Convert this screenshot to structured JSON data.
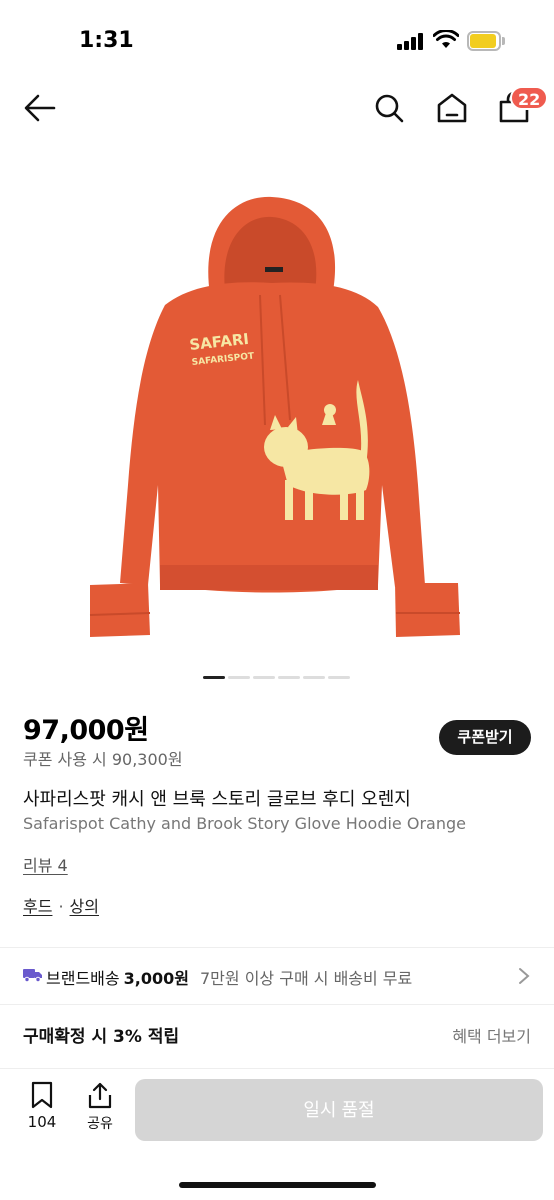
{
  "status_bar": {
    "time": "1:31"
  },
  "nav": {
    "cart_count": "22"
  },
  "gallery": {
    "total_images": 6,
    "active_index": 0,
    "print_text_1": "SAFARI",
    "print_text_2": "SAFARISPOT"
  },
  "product": {
    "price": "97,000원",
    "coupon_price": "쿠폰 사용 시 90,300원",
    "coupon_button": "쿠폰받기",
    "title_ko": "사파리스팟 캐시 앤 브룩 스토리 글로브 후디 오렌지",
    "title_en": "Safarispot Cathy and Brook Story Glove Hoodie Orange",
    "review_label": "리뷰 4",
    "categories": [
      "후드",
      "상의"
    ],
    "category_separator": "·"
  },
  "shipping": {
    "label": "브랜드배송",
    "fee": "3,000원",
    "condition": "7만원 이상 구매 시 배송비 무료"
  },
  "points": {
    "label": "구매확정 시 3% 적립",
    "benefit_link": "혜택 더보기"
  },
  "bottom_bar": {
    "bookmark_count": "104",
    "share_label": "공유",
    "soldout_label": "일시 품절"
  },
  "colors": {
    "badge": "#ef5b4f",
    "hoodie": "#e35a36",
    "print": "#f6e7a4",
    "soldout_bg": "#d5d5d5",
    "coupon_bg": "#1c1c1c",
    "truck": "#6a5acd"
  }
}
